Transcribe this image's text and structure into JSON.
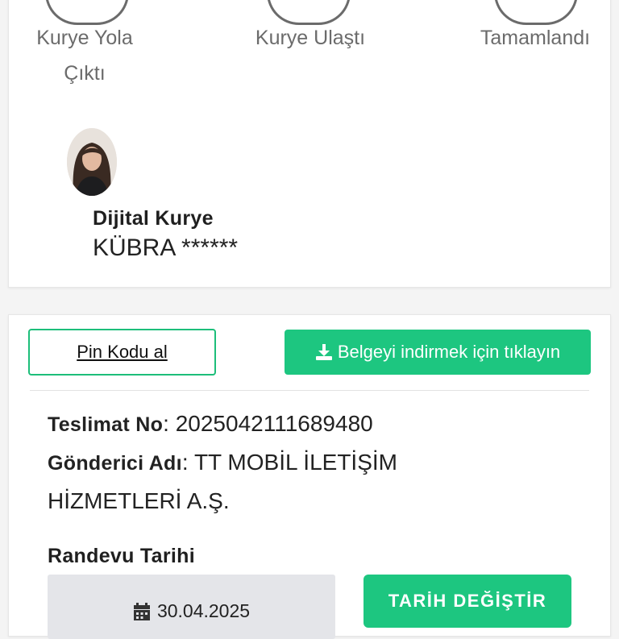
{
  "status_steps": [
    {
      "line1": "Kurye Yola",
      "line2": "Çıktı"
    },
    {
      "line1": "Kurye Ulaştı",
      "line2": ""
    },
    {
      "line1": "Tamamlandı",
      "line2": ""
    }
  ],
  "courier": {
    "title": "Dijital Kurye",
    "name": "KÜBRA ******"
  },
  "actions": {
    "pin_label": "Pin Kodu al",
    "download_label": "Belgeyi indirmek için tıklayın"
  },
  "details": {
    "delivery_no_label": "Teslimat No",
    "delivery_no_value": ": 2025042111689480",
    "sender_label": "Gönderici Adı",
    "sender_value_line1": ": TT MOBİL İLETİŞİM",
    "sender_value_line2": "HİZMETLERİ A.Ş."
  },
  "appointment": {
    "label": "Randevu Tarihi",
    "date": "30.04.2025",
    "change_button": "TARİH DEĞİŞTİR"
  },
  "colors": {
    "accent_green": "#1dc680",
    "step_gray": "#6b6b6b",
    "date_box_bg": "#e4e5e9"
  }
}
